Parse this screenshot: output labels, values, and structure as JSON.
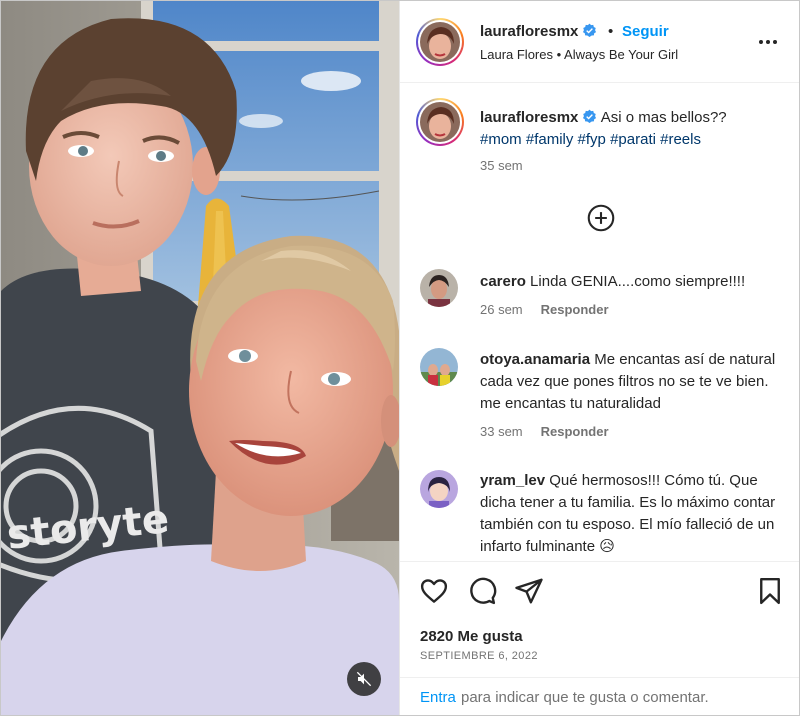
{
  "post": {
    "username": "laurafloresmx",
    "separator": "•",
    "follow_label": "Seguir",
    "subtitle": "Laura Flores • Always Be Your Girl",
    "caption_text": "Asi o mas bellos??",
    "hashtags": [
      "#mom",
      "#family",
      "#fyp",
      "#parati",
      "#reels"
    ],
    "caption_time": "35 sem"
  },
  "comments": [
    {
      "username": "carero",
      "text": "Linda GENIA....como siempre!!!!",
      "time": "26 sem",
      "reply_label": "Responder"
    },
    {
      "username": "otoya.anamaria",
      "text": "Me encantas así de natural cada vez que pones filtros no se te ve bien. me encantas tu naturalidad",
      "time": "33 sem",
      "reply_label": "Responder"
    },
    {
      "username": "yram_lev",
      "text": "Qué hermosos!!! Cómo tú. Que dicha tener a tu familia. Es lo máximo contar también con tu esposo. El mío falleció de un infarto fulminante 😥"
    }
  ],
  "stats": {
    "likes": "2820 Me gusta",
    "date": "SEPTIEMBRE 6, 2022"
  },
  "footer": {
    "enter_label": "Entra",
    "prompt": "para indicar que te gusta o comentar."
  },
  "shirt_text": "storyte",
  "colors": {
    "accent_blue": "#0095f6",
    "hashtag_blue": "#00376b",
    "muted_gray": "#737373",
    "text_dark": "#262626"
  },
  "icons": [
    "verified-badge-icon",
    "more-options-icon",
    "add-circle-icon",
    "heart-icon",
    "comment-icon",
    "share-icon",
    "bookmark-icon",
    "audio-muted-icon"
  ]
}
